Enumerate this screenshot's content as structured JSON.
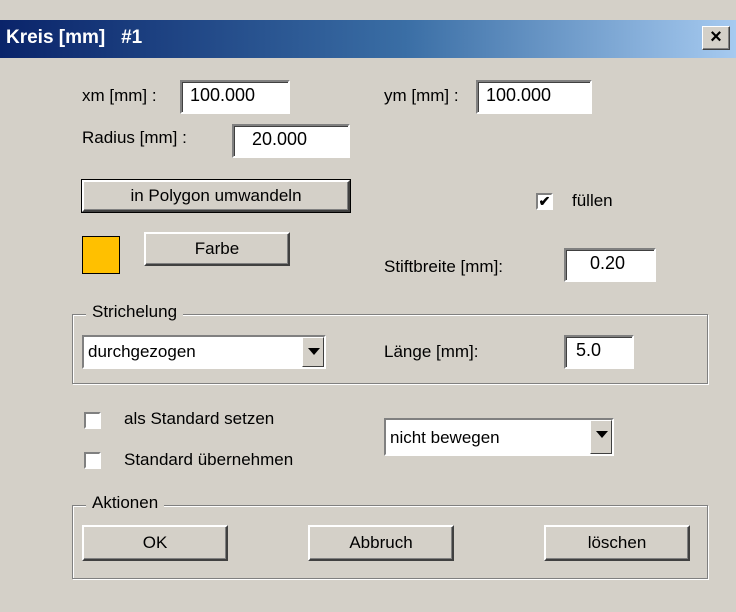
{
  "window": {
    "title": "Kreis [mm]   #1",
    "close_glyph": "×"
  },
  "center": {
    "xm_label": "xm [mm] :",
    "xm_value": "100.000",
    "ym_label": "ym [mm] :",
    "ym_value": "100.000"
  },
  "radius": {
    "label": "Radius [mm] :",
    "value": "20.000"
  },
  "convert_button": "in Polygon umwandeln",
  "fill": {
    "label": "füllen",
    "checked": true
  },
  "color": {
    "button": "Farbe",
    "swatch_color": "#ffc000"
  },
  "pen_width": {
    "label": "Stiftbreite [mm]:",
    "value": "0.20"
  },
  "dashing": {
    "group_label": "Strichelung",
    "style_selected": "durchgezogen",
    "length_label": "Länge [mm]:",
    "length_value": "5.0"
  },
  "options": {
    "set_default_label": "als Standard setzen",
    "set_default_checked": false,
    "apply_default_label": "Standard übernehmen",
    "apply_default_checked": false,
    "move_selected": "nicht bewegen"
  },
  "actions": {
    "group_label": "Aktionen",
    "ok": "OK",
    "cancel": "Abbruch",
    "delete": "löschen"
  }
}
